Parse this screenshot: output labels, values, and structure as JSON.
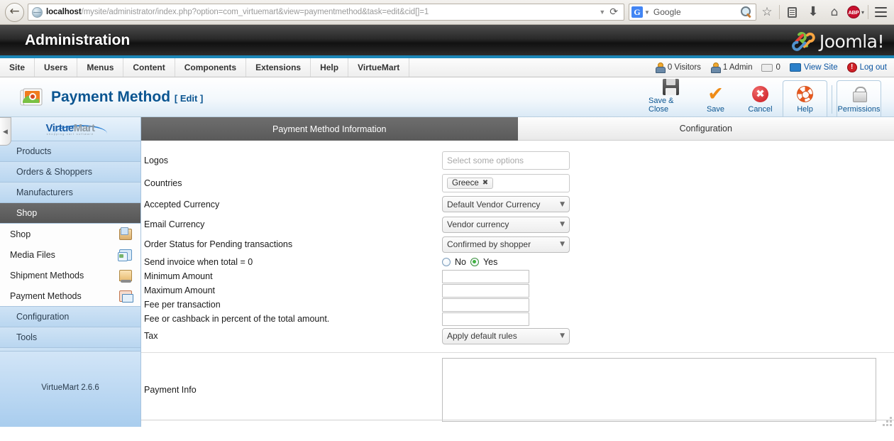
{
  "browser": {
    "url_host": "localhost",
    "url_path": "/mysite/administrator/index.php?option=com_virtuemart&view=paymentmethod&task=edit&cid[]=1",
    "back_glyph": "←",
    "dropdown_glyph": "▼",
    "reload_glyph": "⟳",
    "search_engine": "G",
    "search_placeholder": "Google",
    "star_glyph": "☆",
    "download_glyph": "⬇",
    "home_glyph": "⌂",
    "abp_label": "ABP",
    "abp_caret": "▾"
  },
  "joomla": {
    "admin_title": "Administration",
    "brand": "Joomla!",
    "menu": [
      {
        "label": "Site"
      },
      {
        "label": "Users"
      },
      {
        "label": "Menus"
      },
      {
        "label": "Content"
      },
      {
        "label": "Components"
      },
      {
        "label": "Extensions"
      },
      {
        "label": "Help"
      },
      {
        "label": "VirtueMart"
      }
    ],
    "status": [
      {
        "label": "0 Visitors",
        "icon": "visitors-icon"
      },
      {
        "label": "1 Admin",
        "icon": "admin-icon"
      },
      {
        "label": "0",
        "icon": "messages-icon"
      },
      {
        "label": "View Site",
        "icon": "view-site-icon"
      },
      {
        "label": "Log out",
        "icon": "logout-icon"
      }
    ]
  },
  "page": {
    "title": "Payment Method",
    "title_suffix": "[ Edit ]"
  },
  "toolbar": {
    "buttons": [
      {
        "label": "Save & Close",
        "icon": "floppy-icon"
      },
      {
        "label": "Save",
        "icon": "check-icon"
      },
      {
        "label": "Cancel",
        "icon": "cancel-icon"
      },
      {
        "label": "Help",
        "icon": "lifebuoy-icon"
      },
      {
        "label": "Permissions",
        "icon": "lock-icon"
      }
    ]
  },
  "sidebar": {
    "logo": {
      "part1": "V",
      "part2": "irtue",
      "part3": "Mart",
      "tagline": "shopping cart software"
    },
    "collapse_glyph": "◀",
    "nav": [
      {
        "label": "Products",
        "active": false
      },
      {
        "label": "Orders & Shoppers",
        "active": false
      },
      {
        "label": "Manufacturers",
        "active": false
      },
      {
        "label": "Shop",
        "active": true
      }
    ],
    "subnav": [
      {
        "label": "Shop",
        "icon": "shop-icon"
      },
      {
        "label": "Media Files",
        "icon": "media-files-icon"
      },
      {
        "label": "Shipment Methods",
        "icon": "shipment-icon"
      },
      {
        "label": "Payment Methods",
        "icon": "payment-icon"
      }
    ],
    "nav_after": [
      {
        "label": "Configuration",
        "active": false
      },
      {
        "label": "Tools",
        "active": false
      }
    ],
    "version": "VirtueMart 2.6.6"
  },
  "main": {
    "tabs": [
      {
        "label": "Payment Method Information",
        "active": true
      },
      {
        "label": "Configuration",
        "active": false
      }
    ],
    "fields": {
      "logos": {
        "label": "Logos",
        "placeholder": "Select some options",
        "value": ""
      },
      "countries": {
        "label": "Countries",
        "chip": "Greece",
        "chip_remove": "✖"
      },
      "accepted_currency": {
        "label": "Accepted Currency",
        "value": "Default Vendor Currency"
      },
      "email_currency": {
        "label": "Email Currency",
        "value": "Vendor currency"
      },
      "order_status": {
        "label": "Order Status for Pending transactions",
        "value": "Confirmed by shopper"
      },
      "send_invoice": {
        "label": "Send invoice when total = 0",
        "option_no": "No",
        "option_yes": "Yes",
        "selected": "Yes"
      },
      "minimum_amount": {
        "label": "Minimum Amount",
        "value": ""
      },
      "maximum_amount": {
        "label": "Maximum Amount",
        "value": ""
      },
      "fee_per_transaction": {
        "label": "Fee per transaction",
        "value": ""
      },
      "fee_percent": {
        "label": "Fee or cashback in percent of the total amount.",
        "value": ""
      },
      "tax": {
        "label": "Tax",
        "value": "Apply default rules"
      },
      "payment_info": {
        "label": "Payment Info",
        "value": ""
      }
    },
    "select_caret": "▼"
  },
  "colors": {
    "joomla_blue": "#1c87b8",
    "title_blue": "#0b5591",
    "active_tab_gray": "#6e6e6e",
    "sidebar_blue": "#bcd9f2"
  }
}
